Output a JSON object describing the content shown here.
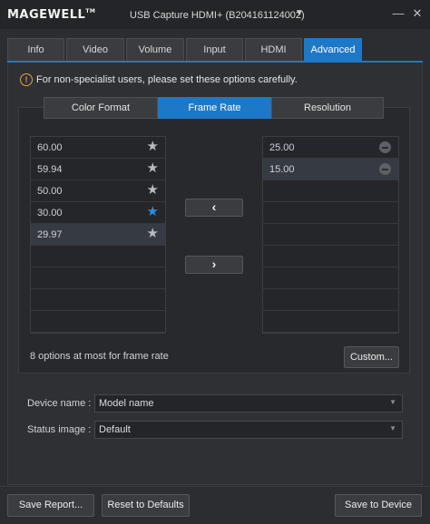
{
  "titlebar": {
    "logo": "MAGEWELL",
    "logo_tm": "TM",
    "device": "USB Capture HDMI+ (B204161124002)",
    "minimize": "—",
    "close": "✕"
  },
  "tabs": [
    "Info",
    "Video",
    "Volume",
    "Input",
    "HDMI",
    "Advanced"
  ],
  "active_tab": "Advanced",
  "warning": {
    "icon": "!",
    "text": "For non-specialist users, please set these options carefully."
  },
  "segments": [
    "Color Format",
    "Frame Rate",
    "Resolution"
  ],
  "active_segment": "Frame Rate",
  "left_list": [
    {
      "label": "60.00",
      "star": "★",
      "favorite": false
    },
    {
      "label": "59.94",
      "star": "★",
      "favorite": false
    },
    {
      "label": "50.00",
      "star": "★",
      "favorite": false
    },
    {
      "label": "30.00",
      "star": "★",
      "favorite": true
    },
    {
      "label": "29.97",
      "star": "★",
      "favorite": false,
      "selected": true
    }
  ],
  "right_list": [
    {
      "label": "25.00"
    },
    {
      "label": "15.00",
      "selected": true
    }
  ],
  "move_buttons": {
    "left": "‹",
    "right": "›"
  },
  "note": "8 options at most for frame rate",
  "custom_button": "Custom...",
  "fields": {
    "device_name_label": "Device name :",
    "device_name_value": "Model name",
    "status_image_label": "Status image :",
    "status_image_value": "Default",
    "caret": "▼"
  },
  "footer": {
    "save_report": "Save Report...",
    "reset": "Reset to Defaults",
    "save_device": "Save to Device"
  },
  "colors": {
    "accent": "#1e78c8",
    "warning": "#e8a33a",
    "background": "#2b2d31"
  }
}
